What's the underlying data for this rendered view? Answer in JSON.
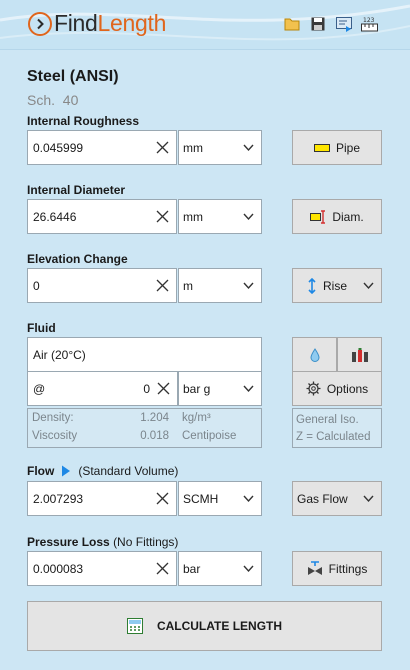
{
  "app": {
    "logo_find": "Find",
    "logo_length": "Length"
  },
  "toolbar": {
    "icons": [
      "open-folder-icon",
      "save-icon",
      "export-icon",
      "units-icon"
    ],
    "units_text": "123"
  },
  "material": {
    "title": "Steel (ANSI)",
    "schedule": "Sch.  40"
  },
  "roughness": {
    "label": "Internal Roughness",
    "value": "0.045999",
    "unit": "mm",
    "button": "Pipe"
  },
  "diameter": {
    "label": "Internal Diameter",
    "value": "26.6446",
    "unit": "mm",
    "button": "Diam."
  },
  "elevation": {
    "label": "Elevation Change",
    "value": "0",
    "unit": "m",
    "button": "Rise"
  },
  "fluid": {
    "label": "Fluid",
    "name": "Air (20°C)",
    "pressure_prefix": "@",
    "pressure_value": "0",
    "pressure_unit": "bar g",
    "options_button": "Options",
    "density_label": "Density:",
    "density_value": "1.204",
    "density_unit": "kg/m³",
    "viscosity_label": "Viscosity",
    "viscosity_value": "0.018",
    "viscosity_unit": "Centipoise",
    "model_line1": "General Iso.",
    "model_line2": "Z = Calculated"
  },
  "flow": {
    "label": "Flow",
    "note": "(Standard Volume)",
    "value": "2.007293",
    "unit": "SCMH",
    "type": "Gas Flow"
  },
  "pressure_loss": {
    "label": "Pressure Loss",
    "note": "(No Fittings)",
    "value": "0.000083",
    "unit": "bar",
    "button": "Fittings"
  },
  "calculate": {
    "label": "CALCULATE LENGTH"
  },
  "colors": {
    "accent": "#e0651c",
    "background": "#cde6f4",
    "button": "#e4e4e4",
    "flow_arrow": "#1e88e5"
  }
}
